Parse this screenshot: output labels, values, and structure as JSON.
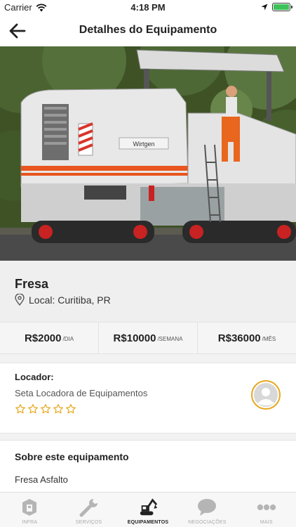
{
  "status_bar": {
    "carrier": "Carrier",
    "time": "4:18 PM"
  },
  "nav": {
    "title": "Detalhes do Equipamento"
  },
  "equipment": {
    "name": "Fresa",
    "location": "Local: Curitiba, PR",
    "image_alt": "Wirtgen"
  },
  "prices": [
    {
      "value": "R$2000",
      "unit": "/DIA"
    },
    {
      "value": "R$10000",
      "unit": "/SEMANA"
    },
    {
      "value": "R$36000",
      "unit": "/MÊS"
    }
  ],
  "locador": {
    "title": "Locador:",
    "name": "Seta Locadora de Equipamentos",
    "rating": 0,
    "max_rating": 5
  },
  "sobre": {
    "title": "Sobre este equipamento",
    "text": "Fresa Asfalto"
  },
  "tabs": [
    {
      "label": "INFRA",
      "icon": "infra-icon",
      "active": false
    },
    {
      "label": "SERVIÇOS",
      "icon": "wrench-icon",
      "active": false
    },
    {
      "label": "EQUIPAMENTOS",
      "icon": "excavator-icon",
      "active": true
    },
    {
      "label": "NEGOCIAÇÕES",
      "icon": "chat-bubble-icon",
      "active": false
    },
    {
      "label": "MAIS",
      "icon": "more-dots-icon",
      "active": false
    }
  ],
  "colors": {
    "accent": "#e6a81e",
    "machine_stripe": "#e8551e"
  }
}
